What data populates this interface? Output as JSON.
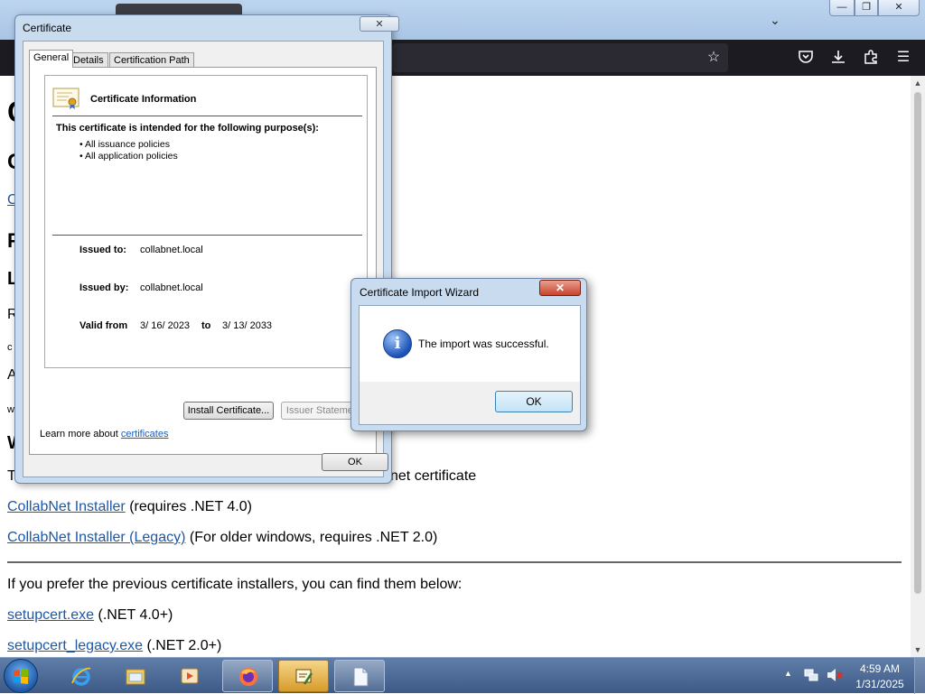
{
  "browser": {
    "tablist_icon": "chevron-down-icon",
    "window_controls": {
      "minimize": "—",
      "maximize": "❐",
      "close": "✕"
    },
    "toolbar_icons": [
      "star-icon",
      "pocket-icon",
      "download-icon",
      "extensions-icon",
      "menu-icon"
    ]
  },
  "page": {
    "frag_c1": "C",
    "frag_c2": "C",
    "frag_c3": "C",
    "frag_p": "P",
    "frag_l": "L",
    "frag_r": "R",
    "frag_c4": "c",
    "frag_a": "A",
    "frag_w": "w",
    "frag_w2": "W",
    "line_t_start": "T",
    "line_t_end": "net certificate",
    "installer_link": "CollabNet Installer",
    "installer_note": "(requires .NET 4.0)",
    "legacy_link": "CollabNet Installer (Legacy)",
    "legacy_note": "(For older windows, requires .NET 2.0)",
    "previous_text": "If you prefer the previous certificate installers, you can find them below:",
    "setupcert_link": "setupcert.exe",
    "setupcert_note": "(.NET 4.0+)",
    "setupcert_legacy_link": "setupcert_legacy.exe",
    "setupcert_legacy_note": "(.NET 2.0+)"
  },
  "certificate_dialog": {
    "title": "Certificate",
    "close_glyph": "✕",
    "tabs": [
      "General",
      "Details",
      "Certification Path"
    ],
    "info_heading": "Certificate Information",
    "purpose_heading": "This certificate is intended for the following purpose(s):",
    "purposes": [
      "• All issuance policies",
      "• All application policies"
    ],
    "issued_to_label": "Issued to:",
    "issued_to_value": "collabnet.local",
    "issued_by_label": "Issued by:",
    "issued_by_value": "collabnet.local",
    "valid_from_label": "Valid from",
    "valid_from_value": "3/ 16/ 2023",
    "valid_to_label": "to",
    "valid_to_value": "3/ 13/ 2033",
    "install_button": "Install Certificate...",
    "issuer_button": "Issuer Statement",
    "learn_more_prefix": "Learn more about ",
    "learn_more_link": "certificates",
    "ok_button": "OK"
  },
  "import_wizard": {
    "title": "Certificate Import Wizard",
    "close_glyph": "✕",
    "message": "The import was successful.",
    "icon_glyph": "i",
    "ok_button": "OK"
  },
  "taskbar": {
    "items": [
      "start-button",
      "internet-explorer",
      "windows-explorer",
      "media-player",
      "firefox",
      "certificate-manager",
      "notepad"
    ],
    "tray_chevron": "▲",
    "clock_time": "4:59 AM",
    "clock_date": "1/31/2025"
  }
}
